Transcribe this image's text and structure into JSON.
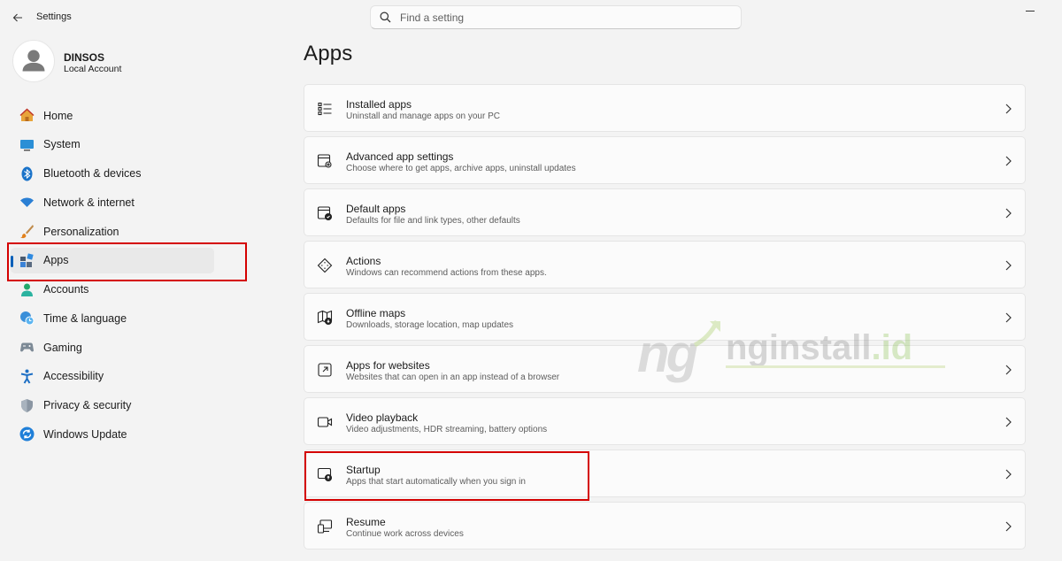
{
  "window": {
    "title": "Settings"
  },
  "search": {
    "placeholder": "Find a setting"
  },
  "user": {
    "name": "DINSOS",
    "account_type": "Local Account"
  },
  "sidebar": {
    "items": [
      {
        "label": "Home",
        "icon": "home-icon"
      },
      {
        "label": "System",
        "icon": "system-icon"
      },
      {
        "label": "Bluetooth & devices",
        "icon": "bluetooth-icon"
      },
      {
        "label": "Network & internet",
        "icon": "wifi-icon"
      },
      {
        "label": "Personalization",
        "icon": "brush-icon"
      },
      {
        "label": "Apps",
        "icon": "apps-icon",
        "selected": true
      },
      {
        "label": "Accounts",
        "icon": "accounts-icon"
      },
      {
        "label": "Time & language",
        "icon": "clock-globe-icon"
      },
      {
        "label": "Gaming",
        "icon": "gamepad-icon"
      },
      {
        "label": "Accessibility",
        "icon": "accessibility-icon"
      },
      {
        "label": "Privacy & security",
        "icon": "shield-icon"
      },
      {
        "label": "Windows Update",
        "icon": "update-icon"
      }
    ]
  },
  "main": {
    "title": "Apps",
    "cards": [
      {
        "title": "Installed apps",
        "subtitle": "Uninstall and manage apps on your PC",
        "icon": "list-icon"
      },
      {
        "title": "Advanced app settings",
        "subtitle": "Choose where to get apps, archive apps, uninstall updates",
        "icon": "app-settings-icon"
      },
      {
        "title": "Default apps",
        "subtitle": "Defaults for file and link types, other defaults",
        "icon": "default-apps-icon"
      },
      {
        "title": "Actions",
        "subtitle": "Windows can recommend actions from these apps.",
        "icon": "actions-icon"
      },
      {
        "title": "Offline maps",
        "subtitle": "Downloads, storage location, map updates",
        "icon": "map-icon"
      },
      {
        "title": "Apps for websites",
        "subtitle": "Websites that can open in an app instead of a browser",
        "icon": "open-external-icon"
      },
      {
        "title": "Video playback",
        "subtitle": "Video adjustments, HDR streaming, battery options",
        "icon": "video-icon"
      },
      {
        "title": "Startup",
        "subtitle": "Apps that start automatically when you sign in",
        "icon": "startup-icon"
      },
      {
        "title": "Resume",
        "subtitle": "Continue work across devices",
        "icon": "resume-icon"
      }
    ]
  },
  "watermark": {
    "prefix": "ng",
    "name": "nginstall",
    "suffix": ".id"
  },
  "colors": {
    "accent": "#005fb8",
    "highlight_box": "#d40000"
  }
}
